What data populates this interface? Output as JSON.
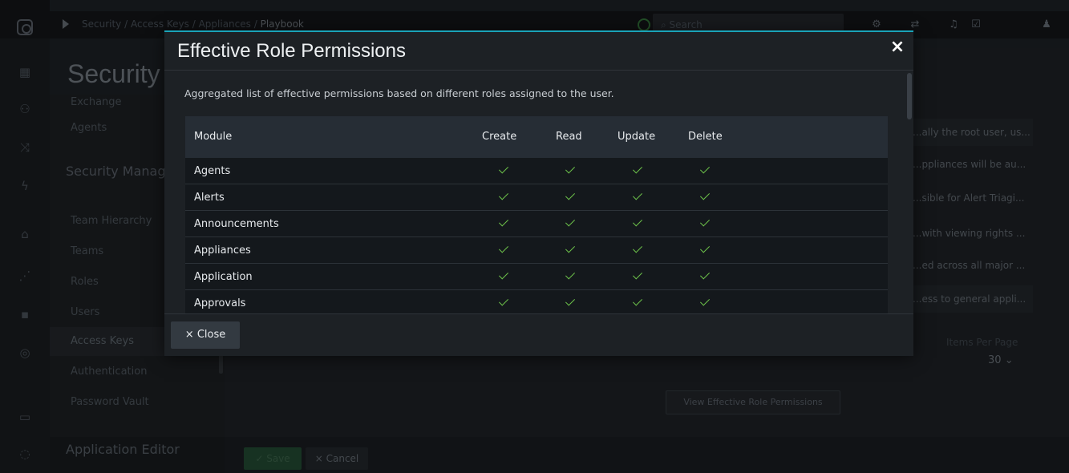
{
  "topbar": {
    "breadcrumb_root": "Security",
    "breadcrumb_sep": "/",
    "breadcrumb_1": "Access Keys",
    "breadcrumb_2": "Appliances",
    "breadcrumb_current": "Playbook",
    "search_placeholder": "Search"
  },
  "page": {
    "title": "Security"
  },
  "sidebar": {
    "items_a": [
      "Exchange",
      "Agents"
    ],
    "section_security": "Security Management",
    "items_b": [
      "Team Hierarchy",
      "Teams",
      "Roles",
      "Users",
      "Access Keys",
      "Authentication",
      "Password Vault"
    ],
    "section_app_editor": "Application Editor"
  },
  "background_table": {
    "rows": [
      "...ally the root user, us...",
      "...ppliances will be au...",
      "...sible for Alert Triagi...",
      "...with viewing rights ...",
      "...ed across all major ...",
      "...ess to general appli..."
    ]
  },
  "pagination": {
    "items_per_page_label": "Items Per Page",
    "items_per_page_value": "30"
  },
  "view_permissions_button": "View Effective Role Permissions",
  "footer": {
    "save_label": "Save",
    "cancel_label": "Cancel"
  },
  "modal": {
    "title": "Effective Role Permissions",
    "description": "Aggregated list of effective permissions based on different roles assigned to the user.",
    "columns": [
      "Module",
      "Create",
      "Read",
      "Update",
      "Delete"
    ],
    "rows": [
      {
        "module": "Agents",
        "create": true,
        "read": true,
        "update": true,
        "delete": true
      },
      {
        "module": "Alerts",
        "create": true,
        "read": true,
        "update": true,
        "delete": true
      },
      {
        "module": "Announcements",
        "create": true,
        "read": true,
        "update": true,
        "delete": true
      },
      {
        "module": "Appliances",
        "create": true,
        "read": true,
        "update": true,
        "delete": true
      },
      {
        "module": "Application",
        "create": true,
        "read": true,
        "update": true,
        "delete": true
      },
      {
        "module": "Approvals",
        "create": true,
        "read": true,
        "update": true,
        "delete": true
      }
    ],
    "close_label": "Close",
    "close_icon": "×"
  },
  "colors": {
    "accent": "#1aa3b8",
    "check": "#6cc04a",
    "modal_bg": "#1d2125"
  }
}
